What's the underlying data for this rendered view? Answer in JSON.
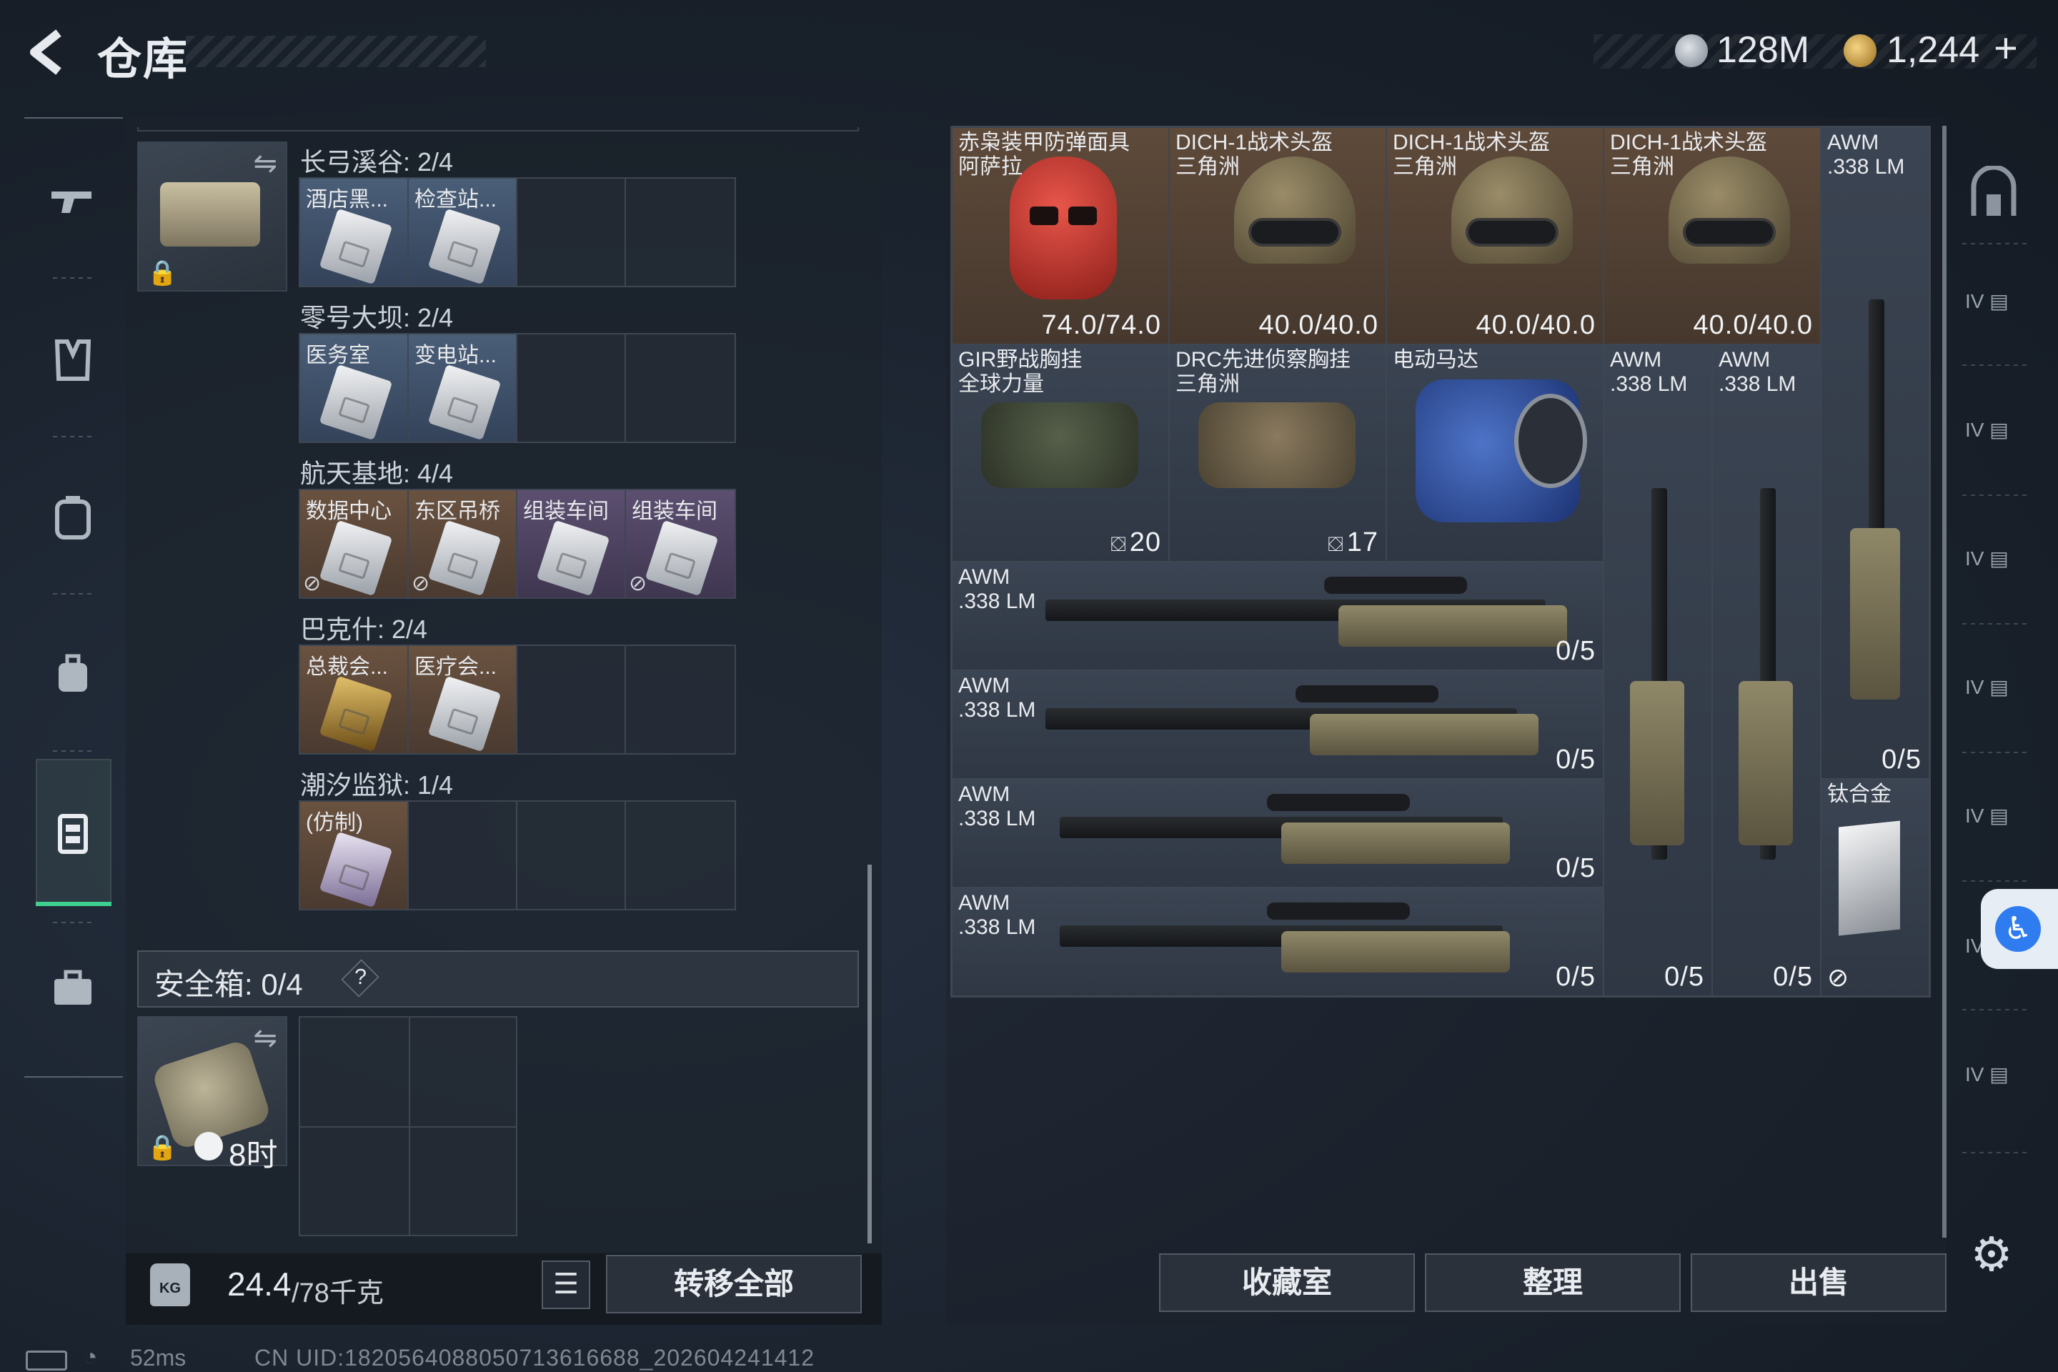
{
  "header": {
    "title": "仓库",
    "currency1_value": "128M",
    "currency2_value": "1,244",
    "currency2_plus": "+"
  },
  "left_nav": {
    "icons": [
      "pistol-icon",
      "vest-icon",
      "backpack-icon",
      "bag-icon",
      "keycard-case-icon",
      "briefcase-icon"
    ],
    "active_index": 4
  },
  "containers": [
    {
      "title": "长弓溪谷: 2/4",
      "slots": [
        {
          "label": "酒店黑...",
          "rarity": "blue"
        },
        {
          "label": "检查站...",
          "rarity": "blue"
        },
        {
          "label": "",
          "rarity": "empty"
        },
        {
          "label": "",
          "rarity": "empty"
        }
      ]
    },
    {
      "title": "零号大坝: 2/4",
      "slots": [
        {
          "label": "医务室",
          "rarity": "blue"
        },
        {
          "label": "变电站...",
          "rarity": "blue"
        },
        {
          "label": "",
          "rarity": "empty"
        },
        {
          "label": "",
          "rarity": "empty"
        }
      ]
    },
    {
      "title": "航天基地: 4/4",
      "slots": [
        {
          "label": "数据中心",
          "rarity": "brown"
        },
        {
          "label": "东区吊桥",
          "rarity": "brown"
        },
        {
          "label": "组装车间",
          "rarity": "purple"
        },
        {
          "label": "组装车间",
          "rarity": "purple"
        }
      ]
    },
    {
      "title": "巴克什: 2/4",
      "slots": [
        {
          "label": "总裁会...",
          "rarity": "brown"
        },
        {
          "label": "医疗会...",
          "rarity": "brown"
        },
        {
          "label": "",
          "rarity": "empty"
        },
        {
          "label": "",
          "rarity": "empty"
        }
      ]
    },
    {
      "title": "潮汐监狱: 1/4",
      "slots": [
        {
          "label": "(仿制)",
          "rarity": "brown"
        },
        {
          "label": "",
          "rarity": "empty"
        },
        {
          "label": "",
          "rarity": "empty"
        },
        {
          "label": "",
          "rarity": "empty"
        }
      ]
    }
  ],
  "safe_box": {
    "label": "安全箱: 0/4",
    "help": "?",
    "timer": "8时"
  },
  "weight": {
    "current": "24.4",
    "max": "/78千克",
    "kg_icon_text": "KG"
  },
  "buttons": {
    "transfer_all": "转移全部",
    "collection": "收藏室",
    "organize": "整理",
    "sell": "出售"
  },
  "inventory": {
    "items": [
      {
        "name_line1": "赤枭装甲防弹面具",
        "name_line2": "阿萨拉",
        "value": "74.0/74.0"
      },
      {
        "name_line1": "DICH-1战术头盔",
        "name_line2": "三角洲",
        "value": "40.0/40.0"
      },
      {
        "name_line1": "DICH-1战术头盔",
        "name_line2": "三角洲",
        "value": "40.0/40.0"
      },
      {
        "name_line1": "DICH-1战术头盔",
        "name_line2": "三角洲",
        "value": "40.0/40.0"
      },
      {
        "name_line1": "AWM",
        "name_line2": ".338 LM",
        "value": "0/5"
      },
      {
        "name_line1": "GIR野战胸挂",
        "name_line2": "全球力量",
        "value": "20"
      },
      {
        "name_line1": "DRC先进侦察胸挂",
        "name_line2": "三角洲",
        "value": "17"
      },
      {
        "name_line1": "电动马达",
        "name_line2": "",
        "value": ""
      },
      {
        "name_line1": "AWM",
        "name_line2": ".338 LM",
        "value": "0/5"
      },
      {
        "name_line1": "AWM",
        "name_line2": ".338 LM",
        "value": "0/5"
      },
      {
        "name_line1": "AWM",
        "name_line2": ".338 LM",
        "value": "0/5"
      },
      {
        "name_line1": "AWM",
        "name_line2": ".338 LM",
        "value": "0/5"
      },
      {
        "name_line1": "AWM",
        "name_line2": ".338 LM",
        "value": "0/5"
      },
      {
        "name_line1": "AWM",
        "name_line2": ".338 LM",
        "value": "0/5"
      },
      {
        "name_line1": "钛合金",
        "name_line2": "",
        "value": ""
      }
    ]
  },
  "right_nav": {
    "tab_labels": [
      "IV",
      "IV",
      "IV",
      "IV",
      "IV",
      "IV"
    ]
  },
  "status": {
    "ping": "52ms",
    "uid": "CN UID:1820564088050713616688_202604241412"
  },
  "colors": {
    "accent_green": "#3fcf8e",
    "rarity_blue": "#4a5e78",
    "rarity_brown": "#6a5240",
    "rarity_purple": "#5c4f70",
    "access_blue": "#2f7cf0"
  }
}
